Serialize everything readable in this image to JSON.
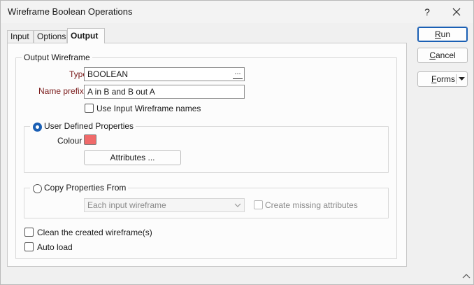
{
  "window": {
    "title": "Wireframe Boolean Operations"
  },
  "titlebar": {
    "help": "?",
    "close_icon": "close-icon"
  },
  "tabs": [
    {
      "label": "Input",
      "active": false
    },
    {
      "label": "Options",
      "active": false
    },
    {
      "label": "Output",
      "active": true
    }
  ],
  "output_wireframe": {
    "legend": "Output Wireframe",
    "type_label": "Type",
    "type_value": "BOOLEAN",
    "type_browse": "...",
    "name_prefix_label": "Name prefix",
    "name_prefix_value": "A in B and B out A",
    "use_input_names_label": "Use Input Wireframe names",
    "use_input_names_checked": false
  },
  "user_defined": {
    "legend": "User Defined Properties",
    "selected": true,
    "colour_label": "Colour",
    "colour_value": "#f06a6a",
    "attributes_button": "Attributes ..."
  },
  "copy_properties": {
    "legend": "Copy Properties From",
    "selected": false,
    "source_value": "Each input wireframe",
    "create_missing_label": "Create missing attributes",
    "create_missing_checked": false
  },
  "options": {
    "clean_label": "Clean the created wireframe(s)",
    "clean_checked": false,
    "auto_load_label": "Auto load",
    "auto_load_checked": false
  },
  "actions": {
    "run": "Run",
    "cancel": "Cancel",
    "forms": "Forms"
  },
  "colors": {
    "accent": "#1a5fb4",
    "label_red": "#7a1a1a"
  }
}
